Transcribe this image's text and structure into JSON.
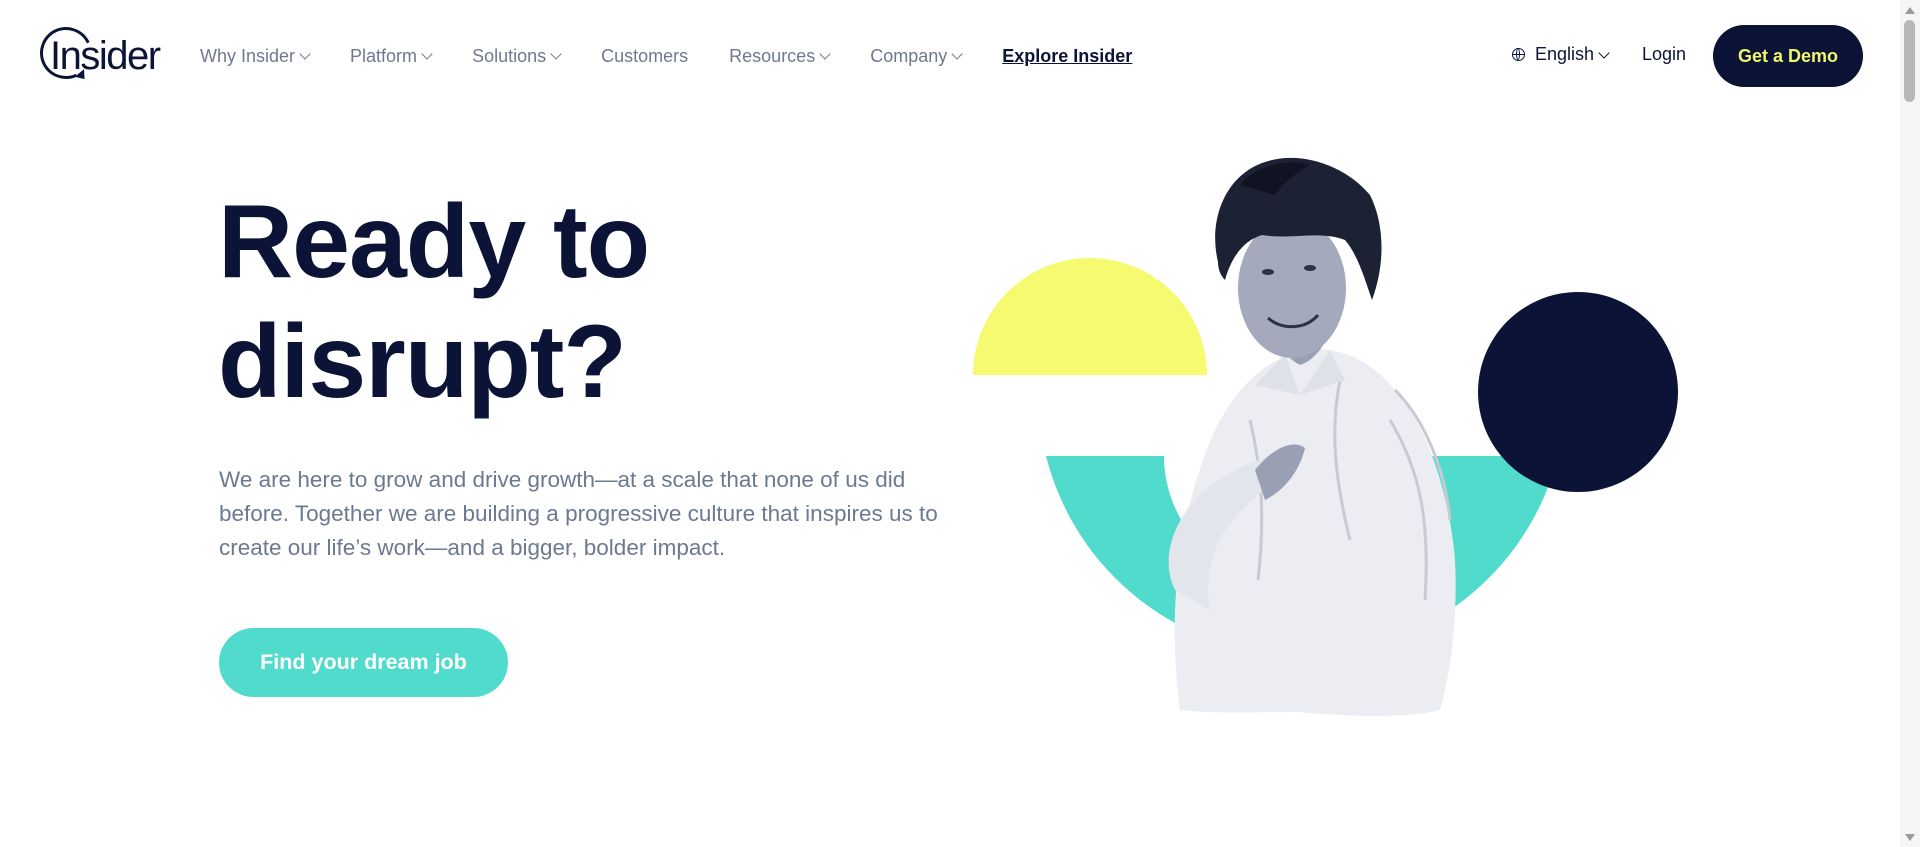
{
  "brand": {
    "logo_text": "Insider"
  },
  "nav": {
    "items": [
      {
        "label": "Why Insider",
        "has_dropdown": true
      },
      {
        "label": "Platform",
        "has_dropdown": true
      },
      {
        "label": "Solutions",
        "has_dropdown": true
      },
      {
        "label": "Customers",
        "has_dropdown": false
      },
      {
        "label": "Resources",
        "has_dropdown": true
      },
      {
        "label": "Company",
        "has_dropdown": true
      }
    ],
    "explore_label": "Explore Insider"
  },
  "header_right": {
    "language_label": "English",
    "language_icon": "globe-icon",
    "login_label": "Login",
    "demo_label": "Get a Demo"
  },
  "hero": {
    "title_line1": "Ready to",
    "title_line2": "disrupt?",
    "body": "We are here to grow and drive growth—at a scale that none of us did before. Together we are building a progressive culture that inspires us to create our life’s work—and a bigger, bolder impact.",
    "cta_label": "Find your dream job"
  },
  "colors": {
    "navy": "#0b1437",
    "teal": "#50dbcc",
    "yellow": "#f5fa70",
    "nav_gray": "#6d7891"
  }
}
